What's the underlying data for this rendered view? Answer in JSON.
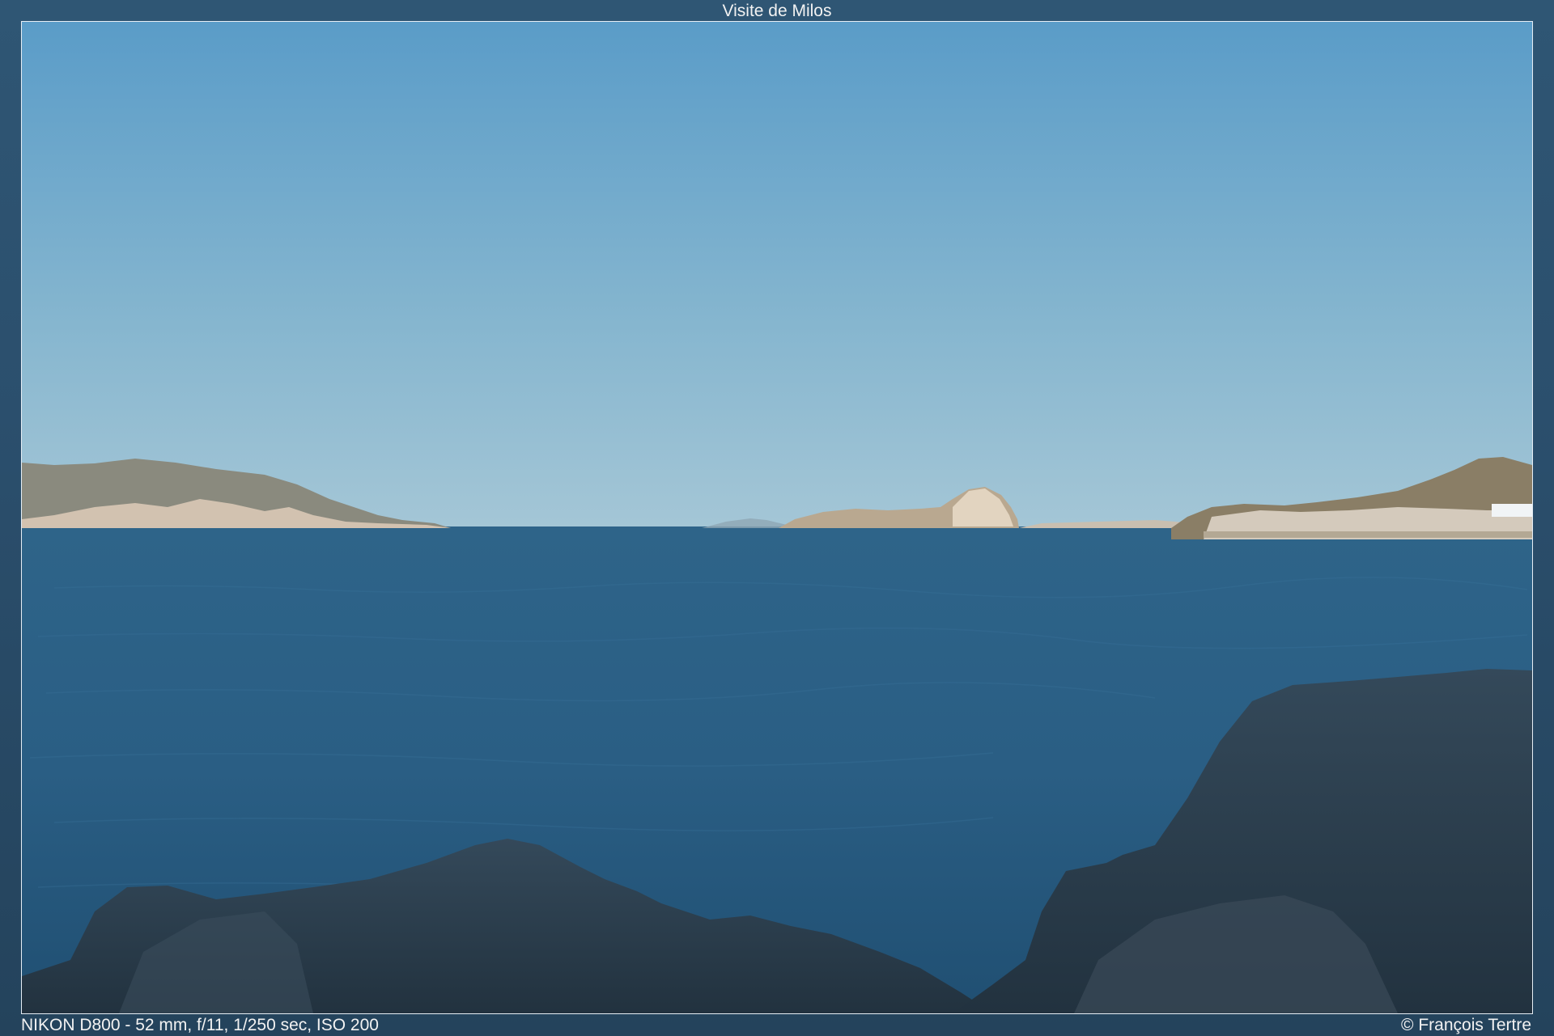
{
  "title": "Visite de Milos",
  "caption": {
    "exif": "NIKON D800 - 52 mm, f/11, 1/250 sec, ISO 200",
    "copyright": "© François Tertre"
  },
  "colors": {
    "sky_top": "#5a9cc8",
    "sky_horizon": "#a4c6d6",
    "sea_far": "#2e6489",
    "sea_near": "#204f72",
    "rock": "#2a3d4c"
  }
}
